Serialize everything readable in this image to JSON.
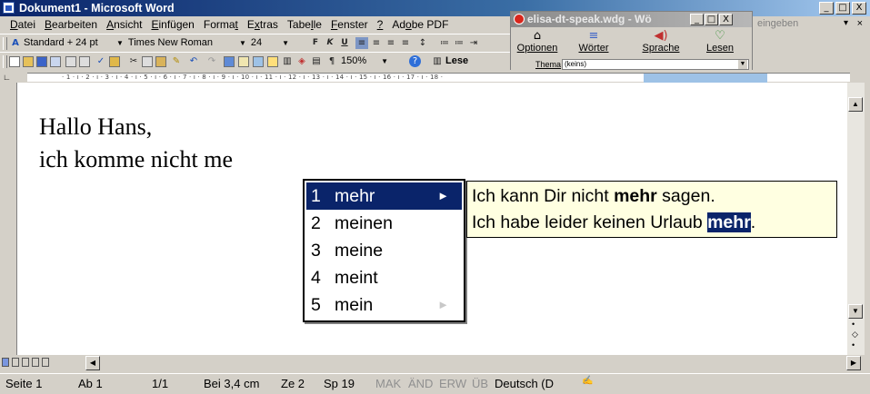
{
  "window": {
    "title": "Dokument1 - Microsoft Word",
    "minimize": "_",
    "maximize": "□",
    "close": "X"
  },
  "menubar": {
    "items": [
      {
        "pre": "",
        "u": "D",
        "post": "atei"
      },
      {
        "pre": "",
        "u": "B",
        "post": "earbeiten"
      },
      {
        "pre": "",
        "u": "A",
        "post": "nsicht"
      },
      {
        "pre": "",
        "u": "E",
        "post": "infügen"
      },
      {
        "pre": "Forma",
        "u": "t",
        "post": ""
      },
      {
        "pre": "E",
        "u": "x",
        "post": "tras"
      },
      {
        "pre": "Tabe",
        "u": "l",
        "post": "le"
      },
      {
        "pre": "",
        "u": "F",
        "post": "enster"
      },
      {
        "pre": "",
        "u": "?",
        "post": ""
      },
      {
        "pre": "Ad",
        "u": "o",
        "post": "be PDF"
      }
    ],
    "help_placeholder": "eingeben",
    "close": "×",
    "dropdown": "▾"
  },
  "format_toolbar": {
    "style": "Standard + 24 pt",
    "font": "Times New Roman",
    "size": "24",
    "bold": "F",
    "italic": "K",
    "underline": "U"
  },
  "standard_toolbar": {
    "zoom": "150%",
    "read_button": "Lese"
  },
  "ruler": {
    "numbers": "· 1 · ı · 2 · ı · 3 · ı · 4 · ı · 5 · ı · 6 · ı · 7 · ı · 8 · ı · 9 · ı · 10 · ı · 11 · ı · 12 · ı · 13 · ı · 14 · ı · 15 · ı · 16 · ı · 17 · ı · 18 ·"
  },
  "document": {
    "line1": "Hallo Hans,",
    "line2": "ich komme nicht me"
  },
  "suggestions": [
    {
      "num": "1",
      "word": "mehr",
      "arrow": "►",
      "selected": true
    },
    {
      "num": "2",
      "word": "meinen",
      "arrow": "",
      "selected": false
    },
    {
      "num": "3",
      "word": "meine",
      "arrow": "",
      "selected": false
    },
    {
      "num": "4",
      "word": "meint",
      "arrow": "",
      "selected": false
    },
    {
      "num": "5",
      "word": "mein",
      "arrow": "►",
      "selected": false
    }
  ],
  "examples": {
    "line1_pre": "Ich kann Dir nicht ",
    "line1_bold": "mehr",
    "line1_post": " sagen.",
    "line2_pre": "Ich habe leider keinen Urlaub ",
    "line2_hl": "mehr",
    "line2_post": "."
  },
  "elisa": {
    "title": "elisa-dt-speak.wdg - Wö",
    "buttons": [
      {
        "icon": "⌂",
        "label": "Optionen"
      },
      {
        "icon": "≡",
        "label": "Wörter"
      },
      {
        "icon": "◀)",
        "label": "Sprache"
      },
      {
        "icon": "♡",
        "label": "Lesen"
      }
    ],
    "thema_label": "Thema",
    "thema_value": "(keins)"
  },
  "statusbar": {
    "page": "Seite 1",
    "section": "Ab 1",
    "pages": "1/1",
    "position": "Bei 3,4 cm",
    "line": "Ze 2",
    "column": "Sp 19",
    "mak": "MAK",
    "aend": "ÄND",
    "erw": "ERW",
    "ueb": "ÜB",
    "language": "Deutsch (D"
  },
  "colors": {
    "selection": "#0a246a",
    "tooltip_bg": "#ffffe1",
    "chrome": "#d4d0c8"
  }
}
